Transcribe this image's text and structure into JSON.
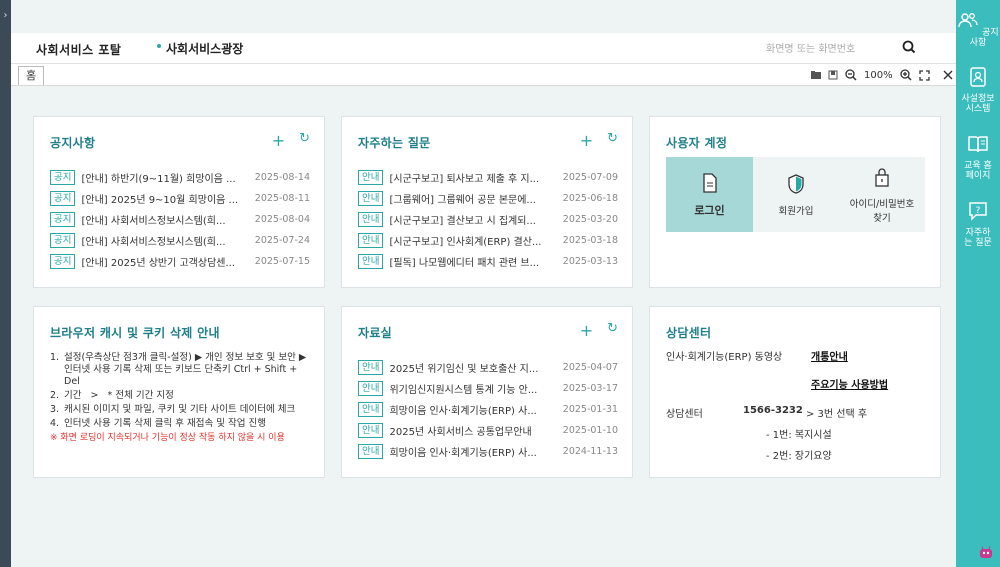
{
  "header": {
    "portal_title": "사회서비스 포탈",
    "plaza": "사회서비스광장",
    "search_placeholder": "화면명 또는 화면번호"
  },
  "tabs": {
    "home": "홈"
  },
  "toolbar": {
    "zoom": "100%"
  },
  "notice": {
    "title": "공지사항",
    "items": [
      {
        "badge": "공지",
        "text": "[안내] 하반기(9~11월) 희망이음 ...",
        "date": "2025-08-14"
      },
      {
        "badge": "공지",
        "text": "[안내] 2025년 9~10월 희망이음 ...",
        "date": "2025-08-11"
      },
      {
        "badge": "공지",
        "text": "[안내] 사회서비스정보시스템(희...",
        "date": "2025-08-04"
      },
      {
        "badge": "공지",
        "text": "[안내] 사회서비스정보시스템(희...",
        "date": "2025-07-24"
      },
      {
        "badge": "공지",
        "text": "[안내] 2025년 상반기 고객상담센...",
        "date": "2025-07-15"
      }
    ]
  },
  "faq": {
    "title": "자주하는 질문",
    "items": [
      {
        "badge": "안내",
        "text": "[시군구보고] 퇴사보고 제출 후 지...",
        "date": "2025-07-09"
      },
      {
        "badge": "안내",
        "text": "[그룹웨어] 그룹웨어 공문 본문에...",
        "date": "2025-06-18"
      },
      {
        "badge": "안내",
        "text": "[시군구보고] 결산보고 시 집계되...",
        "date": "2025-03-20"
      },
      {
        "badge": "안내",
        "text": "[시군구보고] 인사회계(ERP) 결산...",
        "date": "2025-03-18"
      },
      {
        "badge": "안내",
        "text": "[필독] 나모웹에디터 패치 관련 브...",
        "date": "2025-03-13"
      }
    ]
  },
  "account": {
    "title": "사용자 계정",
    "login": "로그인",
    "signup": "회원가입",
    "find": "아이디/비밀번호 찾기"
  },
  "cache": {
    "title": "브라우저 캐시 및 쿠키 삭제 안내",
    "steps": [
      {
        "n": "1.",
        "text": "설정(우측상단 점3개 클릭-설정) ▶ 개인 정보 보호 및 보안 ▶ 인터넷 사용 기록 삭제 또는 키보드 단축키 Ctrl + Shift + Del"
      },
      {
        "n": "2.",
        "text": "기간   >   * 전체 기간 지정"
      },
      {
        "n": "3.",
        "text": "캐시된 이미지 및 파일, 쿠키 및 기타 사이트 데이터에 체크"
      },
      {
        "n": "4.",
        "text": "인터넷 사용 기록 삭제 클릭 후 재접속 및 작업 진행"
      }
    ],
    "warning": "※ 화면 로딩이 지속되거나 기능이 정상 작동 하지 않을 시 이용"
  },
  "data_room": {
    "title": "자료실",
    "items": [
      {
        "badge": "안내",
        "text": "2025년 위기임신 및 보호출산 지...",
        "date": "2025-04-07"
      },
      {
        "badge": "안내",
        "text": "위기임신지원시스템 통계 기능 안...",
        "date": "2025-03-17"
      },
      {
        "badge": "안내",
        "text": "희망이음 인사·회계기능(ERP) 사...",
        "date": "2025-01-31"
      },
      {
        "badge": "안내",
        "text": "2025년 사회서비스 공통업무안내",
        "date": "2025-01-10"
      },
      {
        "badge": "안내",
        "text": "희망이음 인사·회계기능(ERP) 사...",
        "date": "2024-11-13"
      }
    ]
  },
  "counsel": {
    "title": "상담센터",
    "erp_label": "인사·회계기능(ERP) 동영상",
    "link1": "개통안내",
    "link2": "주요기능 사용방법",
    "center_label": "상담센터",
    "phone": "1566-3232",
    "select": "> 3번 선택 후",
    "opt1": "- 1번: 복지시설",
    "opt2": "- 2번: 장기요양"
  },
  "rightbar": {
    "notice": "공지사항",
    "privacy": "사설정보 시스템",
    "edu": "교육 홈페이지",
    "faq": "자주하는 질문"
  },
  "colors": {
    "accent": "#2aa8a8",
    "sidebar": "#3bbdbd",
    "warn": "#e0332b"
  }
}
